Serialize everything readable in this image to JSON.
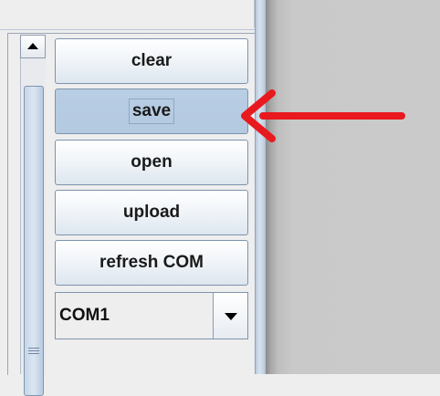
{
  "buttons": {
    "clear": "clear",
    "save": "save",
    "open": "open",
    "upload": "upload",
    "refresh_com": "refresh COM"
  },
  "port_select": {
    "selected": "COM1"
  },
  "icons": {
    "scroll_up": "triangle-up-icon",
    "dropdown": "triangle-down-icon",
    "grip": "grip-lines-icon",
    "annotation": "red-arrow-icon"
  },
  "colors": {
    "annotation_arrow": "#e8191f",
    "active_button": "#b7cce2",
    "window_background": "#eeeeee",
    "outside_area": "#c9c9c9"
  }
}
